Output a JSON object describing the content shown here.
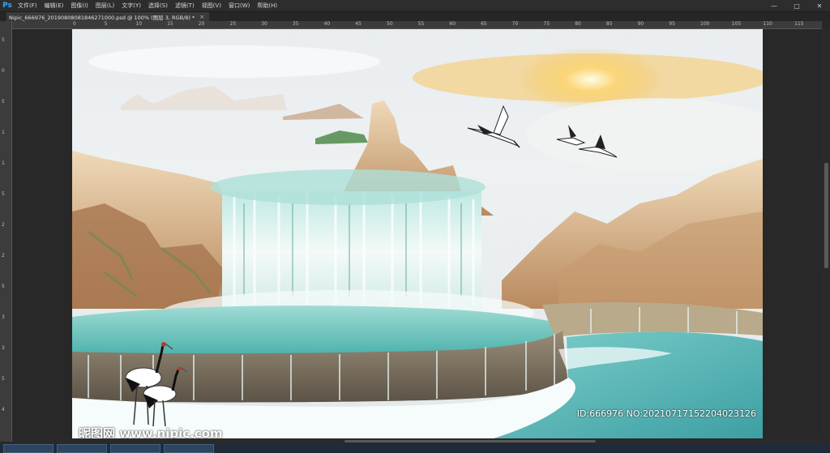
{
  "app": {
    "logo": "Ps"
  },
  "menu": [
    "文件(F)",
    "编辑(E)",
    "图像(I)",
    "图层(L)",
    "文字(Y)",
    "选择(S)",
    "滤镜(T)",
    "视图(V)",
    "窗口(W)",
    "帮助(H)"
  ],
  "window_controls": {
    "minimize": "—",
    "maximize": "□",
    "close": "✕"
  },
  "document_tab": {
    "title": "Nipic_666976_20190808081846271000.psd @ 100% (图层 3, RGB/8) *",
    "close": "×"
  },
  "ruler": {
    "top_labels": [
      "0",
      "5",
      "10",
      "15",
      "20",
      "25",
      "30",
      "35",
      "40",
      "45",
      "50",
      "55",
      "60",
      "65",
      "70",
      "75",
      "80",
      "85",
      "90",
      "95",
      "100",
      "105",
      "110",
      "115",
      "120"
    ],
    "left_labels": [
      "5",
      "0",
      "5",
      "1",
      "1",
      "5",
      "2",
      "2",
      "5",
      "3",
      "3",
      "5",
      "4"
    ]
  },
  "watermark": {
    "logo_text": "昵图网 www.nipic.com",
    "id_text": "ID:666976 NO:20210717152204023126"
  },
  "colors": {
    "ps_blue": "#31a8ff",
    "water": "#5fc4c0",
    "sky_sun": "#f6c65a"
  }
}
